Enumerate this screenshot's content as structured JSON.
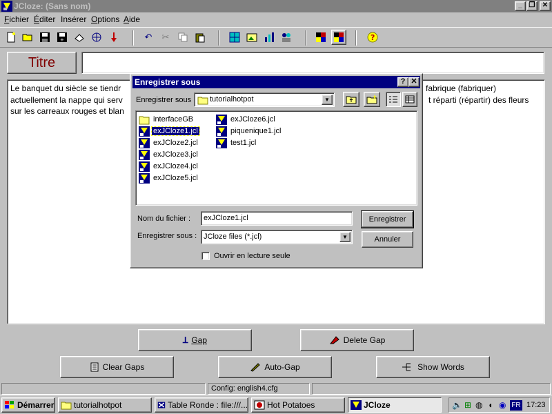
{
  "window": {
    "title": "JCloze: (Sans nom)"
  },
  "menu": [
    "Fichier",
    "Éditer",
    "Insérer",
    "Options",
    "Aide"
  ],
  "titre": {
    "label": "Titre",
    "value": ""
  },
  "main_text": {
    "line1_left": "Le banquet du siècle se tiendr",
    "line1_right": "fabrique (fabriquer)",
    "line2_left": "actuellement la nappe qui serv",
    "line2_right": "t réparti (répartir) des fleurs",
    "line3_left": "sur les carreaux rouges et blan"
  },
  "buttons": {
    "gap": "Gap",
    "delete_gap": "Delete Gap",
    "clear_gaps": "Clear Gaps",
    "auto_gap": "Auto-Gap",
    "show_words": "Show Words"
  },
  "status": {
    "config": "Config: english4.cfg"
  },
  "taskbar": {
    "start": "Démarrer",
    "tasks": [
      "tutorialhotpot",
      "Table Ronde : file:///...",
      "Hot Potatoes",
      "JCloze"
    ],
    "lang": "FR",
    "time": "17:23"
  },
  "dialog": {
    "title": "Enregistrer sous",
    "help_btn": "?",
    "close_btn": "✕",
    "save_in_label": "Enregistrer sous :",
    "save_in_value": "tutorialhotpot",
    "folders": [
      "interfaceGB"
    ],
    "files_col1": [
      "exJCloze1.jcl",
      "exJCloze2.jcl",
      "exJCloze3.jcl",
      "exJCloze4.jcl",
      "exJCloze5.jcl"
    ],
    "files_col2": [
      "exJCloze6.jcl",
      "piquenique1.jcl",
      "test1.jcl"
    ],
    "selected_file": "exJCloze1.jcl",
    "filename_label": "Nom du fichier :",
    "filename_value": "exJCloze1.jcl",
    "type_label": "Enregistrer sous :",
    "type_value": "JCloze files (*.jcl)",
    "readonly_label": "Ouvrir en lecture seule",
    "save_button": "Enregistrer",
    "cancel_button": "Annuler"
  },
  "colors": {
    "titlebar_inactive": "#808080",
    "dialog_title": "#000080",
    "titre_label": "#800000",
    "desktop_face": "#c0c0c0"
  }
}
